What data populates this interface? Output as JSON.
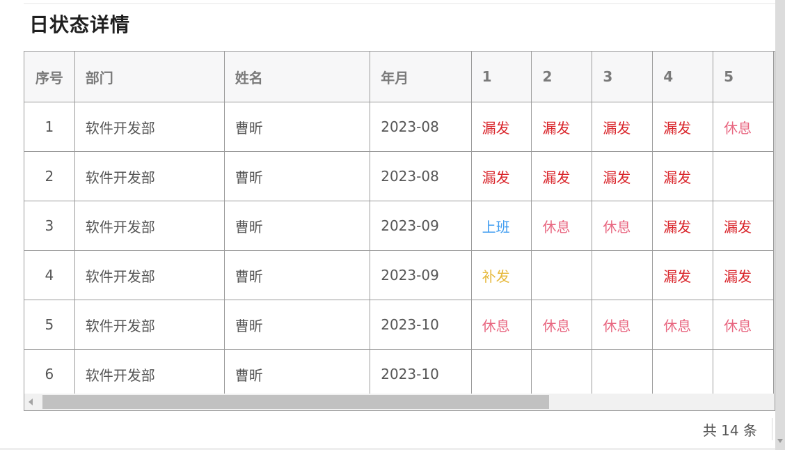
{
  "page": {
    "title": "日状态详情"
  },
  "table": {
    "headers": [
      "序号",
      "部门",
      "姓名",
      "年月",
      "1",
      "2",
      "3",
      "4",
      "5"
    ],
    "rows": [
      {
        "index": "1",
        "department": "软件开发部",
        "name": "曹昕",
        "month": "2023-08",
        "days": [
          "漏发",
          "漏发",
          "漏发",
          "漏发",
          "休息"
        ]
      },
      {
        "index": "2",
        "department": "软件开发部",
        "name": "曹昕",
        "month": "2023-08",
        "days": [
          "漏发",
          "漏发",
          "漏发",
          "漏发",
          ""
        ]
      },
      {
        "index": "3",
        "department": "软件开发部",
        "name": "曹昕",
        "month": "2023-09",
        "days": [
          "上班",
          "休息",
          "休息",
          "漏发",
          "漏发"
        ]
      },
      {
        "index": "4",
        "department": "软件开发部",
        "name": "曹昕",
        "month": "2023-09",
        "days": [
          "补发",
          "",
          "",
          "漏发",
          "漏发"
        ]
      },
      {
        "index": "5",
        "department": "软件开发部",
        "name": "曹昕",
        "month": "2023-10",
        "days": [
          "休息",
          "休息",
          "休息",
          "休息",
          "休息"
        ]
      },
      {
        "index": "6",
        "department": "软件开发部",
        "name": "曹昕",
        "month": "2023-10",
        "days": [
          "",
          "",
          "",
          "",
          ""
        ]
      }
    ]
  },
  "status_colors": {
    "漏发": "#d9242a",
    "休息": "#e8657f",
    "上班": "#3f9cf0",
    "补发": "#e6b83a"
  },
  "pagination": {
    "total_text": "共 14 条"
  },
  "scroll": {
    "horizontal_position": 0.0,
    "horizontal_visible_fraction": 0.7
  }
}
